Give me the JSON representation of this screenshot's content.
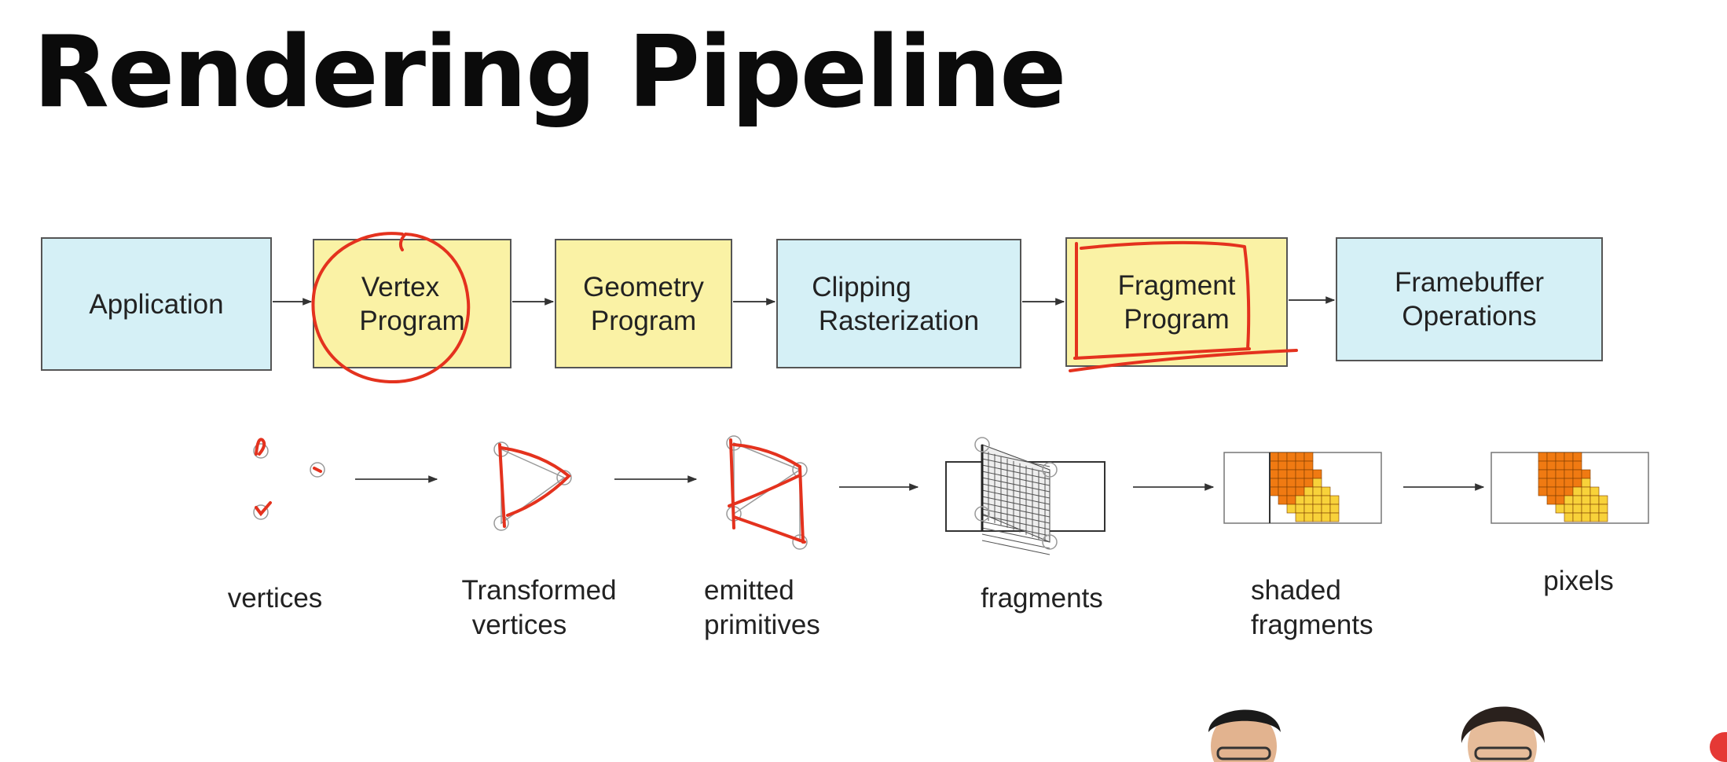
{
  "slide": {
    "title": "Rendering Pipeline"
  },
  "pipeline": {
    "stages": [
      {
        "id": "application",
        "lines": [
          "Application"
        ],
        "fill": "blue"
      },
      {
        "id": "vertex-program",
        "lines": [
          "Vertex",
          "Program"
        ],
        "fill": "yellow",
        "annotation": "circled"
      },
      {
        "id": "geometry-program",
        "lines": [
          "Geometry",
          "Program"
        ],
        "fill": "yellow"
      },
      {
        "id": "clipping-rasterization",
        "lines": [
          "Clipping",
          "Rasterization"
        ],
        "fill": "blue"
      },
      {
        "id": "fragment-program",
        "lines": [
          "Fragment",
          "Program"
        ],
        "fill": "yellow",
        "annotation": "boxed"
      },
      {
        "id": "framebuffer-operations",
        "lines": [
          "Framebuffer",
          "Operations"
        ],
        "fill": "blue"
      }
    ]
  },
  "captions": [
    {
      "id": "vertices",
      "lines": [
        "vertices"
      ]
    },
    {
      "id": "transformed-vertices",
      "lines": [
        "Transformed",
        "vertices"
      ]
    },
    {
      "id": "emitted-primitives",
      "lines": [
        "emitted",
        "primitives"
      ]
    },
    {
      "id": "fragments",
      "lines": [
        "fragments"
      ]
    },
    {
      "id": "shaded-fragments",
      "lines": [
        "shaded",
        "fragments"
      ]
    },
    {
      "id": "pixels",
      "lines": [
        "pixels"
      ]
    }
  ],
  "colors": {
    "stage_blue": "#d5f0f6",
    "stage_yellow": "#faf2a5",
    "ink_red": "#e4321e",
    "fragment_orange": "#f07a12",
    "fragment_yellow": "#f8d23a"
  }
}
